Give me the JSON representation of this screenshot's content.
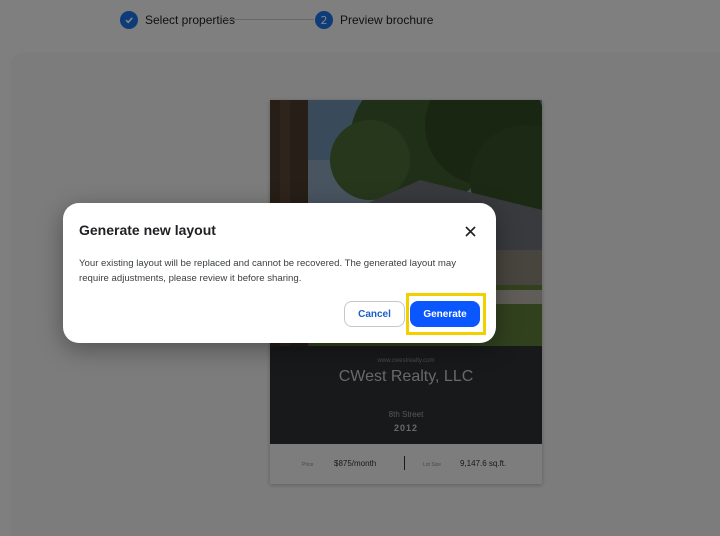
{
  "stepper": {
    "step1": {
      "label": "Select properties",
      "status": "completed",
      "icon": "check-icon"
    },
    "step2": {
      "label": "Preview brochure",
      "number": "2",
      "status": "current"
    }
  },
  "brochure": {
    "website": "www.cwestrealty.com",
    "company": "CWest Realty, LLC",
    "street": "8th Street",
    "year": "2012",
    "price_label": "Price",
    "price_value": "$875/month",
    "lot_label": "Lot Size",
    "lot_value": "9,147.6 sq.ft."
  },
  "dialog": {
    "title": "Generate new layout",
    "body": "Your existing layout will be replaced and cannot be recovered. The generated layout may require adjustments, please review it before sharing.",
    "cancel_label": "Cancel",
    "generate_label": "Generate"
  },
  "colors": {
    "accent": "#1a73e8",
    "primary_button": "#0b57ff",
    "highlight": "#f2d000",
    "brochure_dark": "#2f3033"
  }
}
